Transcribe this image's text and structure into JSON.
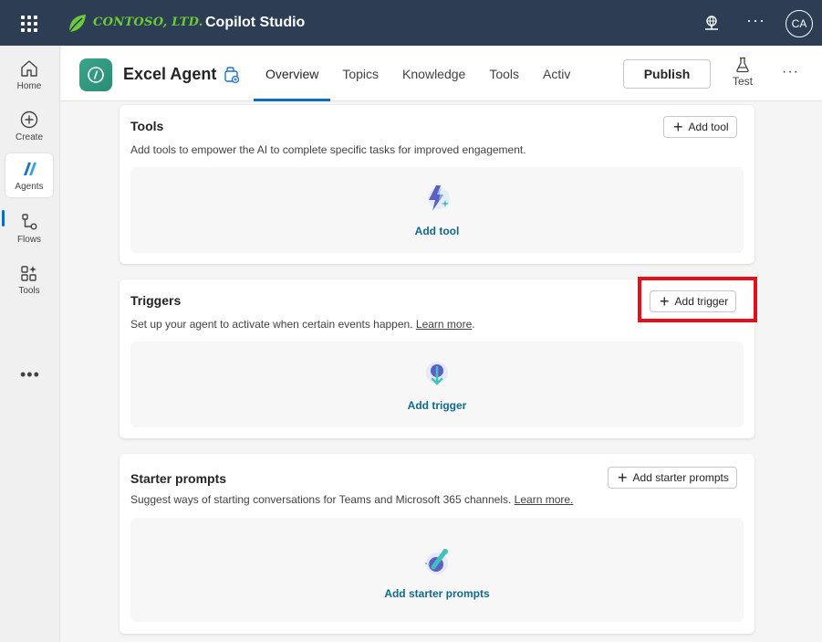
{
  "topbar": {
    "brand": "CONTOSO, LTD.",
    "app_title": "Copilot Studio",
    "more": "···",
    "avatar_initials": "CA"
  },
  "rail": {
    "items": [
      {
        "label": "Home",
        "icon": "home-icon"
      },
      {
        "label": "Create",
        "icon": "create-icon"
      },
      {
        "label": "Agents",
        "icon": "agents-icon"
      },
      {
        "label": "Flows",
        "icon": "flows-icon"
      },
      {
        "label": "Tools",
        "icon": "tools-icon"
      }
    ],
    "more": "•••"
  },
  "agent_header": {
    "name": "Excel Agent",
    "tabs": [
      "Overview",
      "Topics",
      "Knowledge",
      "Tools",
      "Activ"
    ],
    "active_tab": "Overview",
    "publish_label": "Publish",
    "test_label": "Test",
    "more": "···"
  },
  "cards": {
    "tools": {
      "title": "Tools",
      "description": "Add tools to empower the AI to complete specific tasks for improved engagement.",
      "button_label": "Add tool",
      "empty_link": "Add tool"
    },
    "triggers": {
      "title": "Triggers",
      "description": "Set up your agent to activate when certain events happen.",
      "learn_more": "Learn more",
      "period": ".",
      "button_label": "Add trigger",
      "empty_link": "Add trigger"
    },
    "starter_prompts": {
      "title": "Starter prompts",
      "description": "Suggest ways of starting conversations for Teams and Microsoft 365 channels.",
      "learn_more": "Learn more.",
      "button_label": "Add starter prompts",
      "empty_link": "Add starter prompts"
    }
  },
  "colors": {
    "topbar_bg": "#2c3d54",
    "accent": "#0f6cbd",
    "link_teal": "#116a8a",
    "brand_green": "#6ccb3a",
    "highlight": "#e3101b"
  }
}
